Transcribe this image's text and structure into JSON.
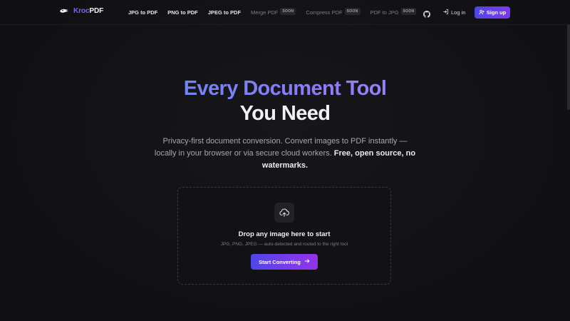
{
  "brand": {
    "prefix": "Kroc",
    "suffix": "PDF"
  },
  "nav": {
    "links": [
      {
        "label": "JPG to PDF"
      },
      {
        "label": "PNG to PDF"
      },
      {
        "label": "JPEG to PDF"
      }
    ],
    "coming_soon": [
      {
        "label": "Merge PDF",
        "badge": "SOON"
      },
      {
        "label": "Compress PDF",
        "badge": "SOON"
      },
      {
        "label": "PDF to JPG",
        "badge": "SOON"
      }
    ],
    "github_icon": "github-icon",
    "login_label": "Log in",
    "signup_label": "Sign up"
  },
  "hero": {
    "title_gradient": "Every Document Tool",
    "title_plain": "You Need",
    "subtitle_part1": "Privacy-first document conversion. Convert images to PDF instantly — locally in your browser or via secure cloud workers.",
    "subtitle_bold": "Free, open source, no watermarks."
  },
  "dropzone": {
    "icon": "cloud-upload-icon",
    "title": "Drop any image here to start",
    "subtitle": "JPG, PNG, JPEG — auto-detected and routed to the right tool",
    "button_label": "Start Converting"
  },
  "colors": {
    "background": "#121214",
    "accent_start": "#4f46e5",
    "accent_end": "#7c3aed",
    "brand_accent": "#8b5cf6"
  }
}
